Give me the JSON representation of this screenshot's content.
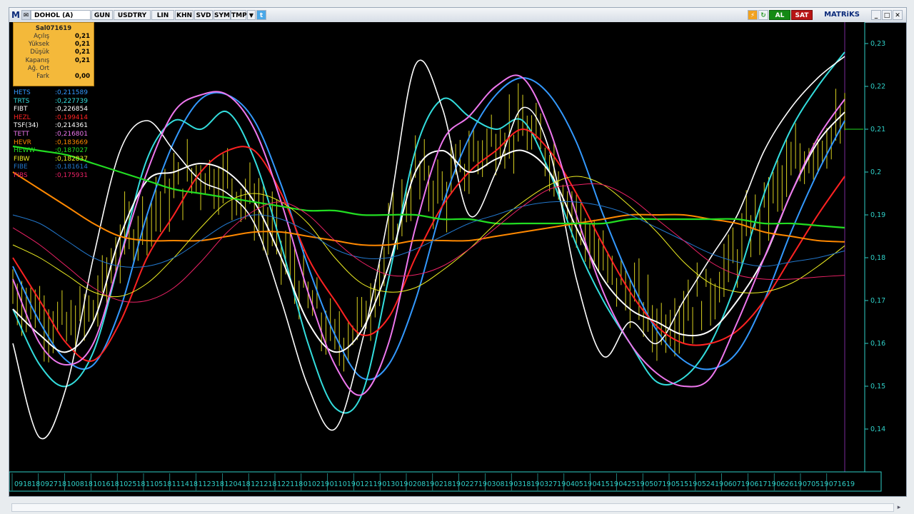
{
  "toolbar": {
    "logo": "M",
    "symbol": "DOHOL (A)",
    "period": "GUN",
    "currency": "USDTRY",
    "scale_linear": "LIN",
    "khn": "KHN",
    "svd": "SVD",
    "sym": "SYM",
    "tmp": "TMP",
    "buy": "AL",
    "sell": "SAT",
    "brand": "MATRiKS"
  },
  "info": {
    "date": "Sal071619",
    "rows": [
      {
        "label": "Açılış",
        "value": "0,21"
      },
      {
        "label": "Yüksek",
        "value": "0,21"
      },
      {
        "label": "Düşük",
        "value": "0,21"
      },
      {
        "label": "Kapanış",
        "value": "0,21"
      },
      {
        "label": "Ağ. Ort",
        "value": ""
      },
      {
        "label": "Fark",
        "value": "0,00"
      }
    ]
  },
  "colors": {
    "HETS": "#3399ff",
    "TRTS": "#33dddd",
    "FIBT": "#ffffff",
    "HEZL": "#ff2222",
    "TSF": "#ffffff",
    "TETT": "#ee77ee",
    "HEVR": "#ff8800",
    "HEWW": "#22dd22",
    "FIBW": "#eeee22",
    "FIBE": "#2277cc",
    "FIBS": "#ee2266",
    "price": "#d8d020"
  },
  "chart_data": {
    "type": "line",
    "title": "DOHOL (A)",
    "ylim": [
      0.13,
      0.235
    ],
    "y_ticks": [
      "0,14",
      "0,15",
      "0,16",
      "0,17",
      "0,18",
      "0,19",
      "0,2",
      "0,21",
      "0,22",
      "0,23"
    ],
    "y_tick_values": [
      0.14,
      0.15,
      0.16,
      0.17,
      0.18,
      0.19,
      0.2,
      0.21,
      0.22,
      0.23
    ],
    "x_ticks": [
      "091818",
      "092718",
      "100818",
      "101618",
      "102518",
      "110518",
      "111418",
      "112318",
      "120418",
      "121218",
      "122118",
      "010219",
      "011019",
      "012119",
      "013019",
      "020819",
      "021819",
      "022719",
      "030819",
      "031819",
      "032719",
      "040519",
      "041519",
      "042519",
      "050719",
      "051519",
      "052419",
      "060719",
      "061719",
      "062619",
      "070519",
      "071619"
    ],
    "last_value": 0.21,
    "series": [
      {
        "name": "HETS",
        "last": "0,211589",
        "values": [
          0.178,
          0.165,
          0.156,
          0.155,
          0.168,
          0.19,
          0.207,
          0.217,
          0.218,
          0.212,
          0.197,
          0.178,
          0.162,
          0.152,
          0.155,
          0.17,
          0.192,
          0.208,
          0.218,
          0.222,
          0.218,
          0.207,
          0.19,
          0.175,
          0.163,
          0.156,
          0.154,
          0.158,
          0.17,
          0.186,
          0.2,
          0.212
        ]
      },
      {
        "name": "TRTS",
        "last": "0,227739",
        "values": [
          0.168,
          0.155,
          0.15,
          0.158,
          0.18,
          0.203,
          0.212,
          0.21,
          0.214,
          0.203,
          0.183,
          0.16,
          0.145,
          0.148,
          0.175,
          0.205,
          0.217,
          0.213,
          0.21,
          0.212,
          0.2,
          0.183,
          0.17,
          0.16,
          0.151,
          0.152,
          0.16,
          0.175,
          0.195,
          0.21,
          0.22,
          0.228
        ]
      },
      {
        "name": "FIBT",
        "last": "0,226854",
        "values": [
          0.16,
          0.138,
          0.15,
          0.18,
          0.205,
          0.212,
          0.205,
          0.198,
          0.195,
          0.188,
          0.17,
          0.15,
          0.14,
          0.16,
          0.19,
          0.225,
          0.215,
          0.19,
          0.2,
          0.215,
          0.205,
          0.175,
          0.157,
          0.165,
          0.16,
          0.17,
          0.18,
          0.19,
          0.205,
          0.215,
          0.222,
          0.227
        ]
      },
      {
        "name": "HEZL",
        "last": "0,199414",
        "values": [
          0.18,
          0.17,
          0.16,
          0.156,
          0.165,
          0.18,
          0.19,
          0.2,
          0.205,
          0.205,
          0.195,
          0.18,
          0.17,
          0.162,
          0.166,
          0.18,
          0.192,
          0.2,
          0.205,
          0.21,
          0.205,
          0.195,
          0.183,
          0.172,
          0.164,
          0.16,
          0.16,
          0.163,
          0.17,
          0.18,
          0.19,
          0.199
        ]
      },
      {
        "name": "TSF(34)",
        "last": "0,214361",
        "values": [
          0.168,
          0.162,
          0.158,
          0.165,
          0.185,
          0.198,
          0.2,
          0.202,
          0.2,
          0.193,
          0.18,
          0.165,
          0.158,
          0.163,
          0.178,
          0.2,
          0.205,
          0.2,
          0.203,
          0.205,
          0.2,
          0.187,
          0.175,
          0.168,
          0.165,
          0.162,
          0.163,
          0.17,
          0.18,
          0.195,
          0.207,
          0.214
        ]
      },
      {
        "name": "TETT",
        "last": "0,216801",
        "values": [
          0.175,
          0.16,
          0.155,
          0.16,
          0.18,
          0.2,
          0.214,
          0.218,
          0.218,
          0.21,
          0.193,
          0.172,
          0.155,
          0.148,
          0.16,
          0.187,
          0.207,
          0.213,
          0.22,
          0.222,
          0.21,
          0.19,
          0.172,
          0.16,
          0.153,
          0.15,
          0.152,
          0.165,
          0.18,
          0.195,
          0.208,
          0.217
        ]
      },
      {
        "name": "HEVR",
        "last": "0,183669",
        "values": [
          0.2,
          0.196,
          0.192,
          0.188,
          0.185,
          0.184,
          0.184,
          0.184,
          0.185,
          0.186,
          0.186,
          0.185,
          0.184,
          0.183,
          0.183,
          0.184,
          0.184,
          0.184,
          0.185,
          0.186,
          0.187,
          0.188,
          0.189,
          0.19,
          0.19,
          0.19,
          0.189,
          0.188,
          0.186,
          0.185,
          0.184,
          0.1837
        ]
      },
      {
        "name": "HEWW",
        "last": "0,187027",
        "values": [
          0.206,
          0.205,
          0.204,
          0.202,
          0.2,
          0.198,
          0.196,
          0.195,
          0.194,
          0.193,
          0.192,
          0.191,
          0.191,
          0.19,
          0.19,
          0.19,
          0.189,
          0.189,
          0.188,
          0.188,
          0.188,
          0.188,
          0.188,
          0.189,
          0.189,
          0.189,
          0.189,
          0.189,
          0.188,
          0.188,
          0.1875,
          0.187
        ]
      },
      {
        "name": "FIBW",
        "last": "0,182837",
        "values": [
          0.183,
          0.18,
          0.176,
          0.172,
          0.171,
          0.174,
          0.18,
          0.187,
          0.193,
          0.195,
          0.193,
          0.188,
          0.18,
          0.174,
          0.172,
          0.173,
          0.177,
          0.182,
          0.188,
          0.193,
          0.197,
          0.199,
          0.197,
          0.192,
          0.186,
          0.179,
          0.174,
          0.172,
          0.172,
          0.174,
          0.178,
          0.1828
        ]
      },
      {
        "name": "FIBE",
        "last": "0,181614",
        "values": [
          0.19,
          0.188,
          0.184,
          0.18,
          0.178,
          0.178,
          0.18,
          0.184,
          0.188,
          0.19,
          0.189,
          0.186,
          0.182,
          0.18,
          0.18,
          0.182,
          0.185,
          0.188,
          0.19,
          0.192,
          0.193,
          0.193,
          0.192,
          0.19,
          0.187,
          0.184,
          0.181,
          0.179,
          0.178,
          0.179,
          0.18,
          0.1816
        ]
      },
      {
        "name": "FIBS",
        "last": "0,175931",
        "values": [
          0.187,
          0.183,
          0.178,
          0.173,
          0.17,
          0.17,
          0.173,
          0.179,
          0.186,
          0.191,
          0.193,
          0.19,
          0.184,
          0.179,
          0.176,
          0.176,
          0.178,
          0.182,
          0.187,
          0.192,
          0.196,
          0.197,
          0.197,
          0.194,
          0.189,
          0.184,
          0.179,
          0.176,
          0.175,
          0.175,
          0.1755,
          0.1759
        ]
      }
    ],
    "price_bars": {
      "name": "DOHOL (A)",
      "values": [
        0.172,
        0.168,
        0.163,
        0.168,
        0.183,
        0.19,
        0.196,
        0.2,
        0.198,
        0.193,
        0.182,
        0.17,
        0.16,
        0.165,
        0.182,
        0.2,
        0.195,
        0.203,
        0.208,
        0.21,
        0.204,
        0.19,
        0.178,
        0.172,
        0.164,
        0.168,
        0.172,
        0.181,
        0.192,
        0.2,
        0.207,
        0.21
      ]
    }
  }
}
